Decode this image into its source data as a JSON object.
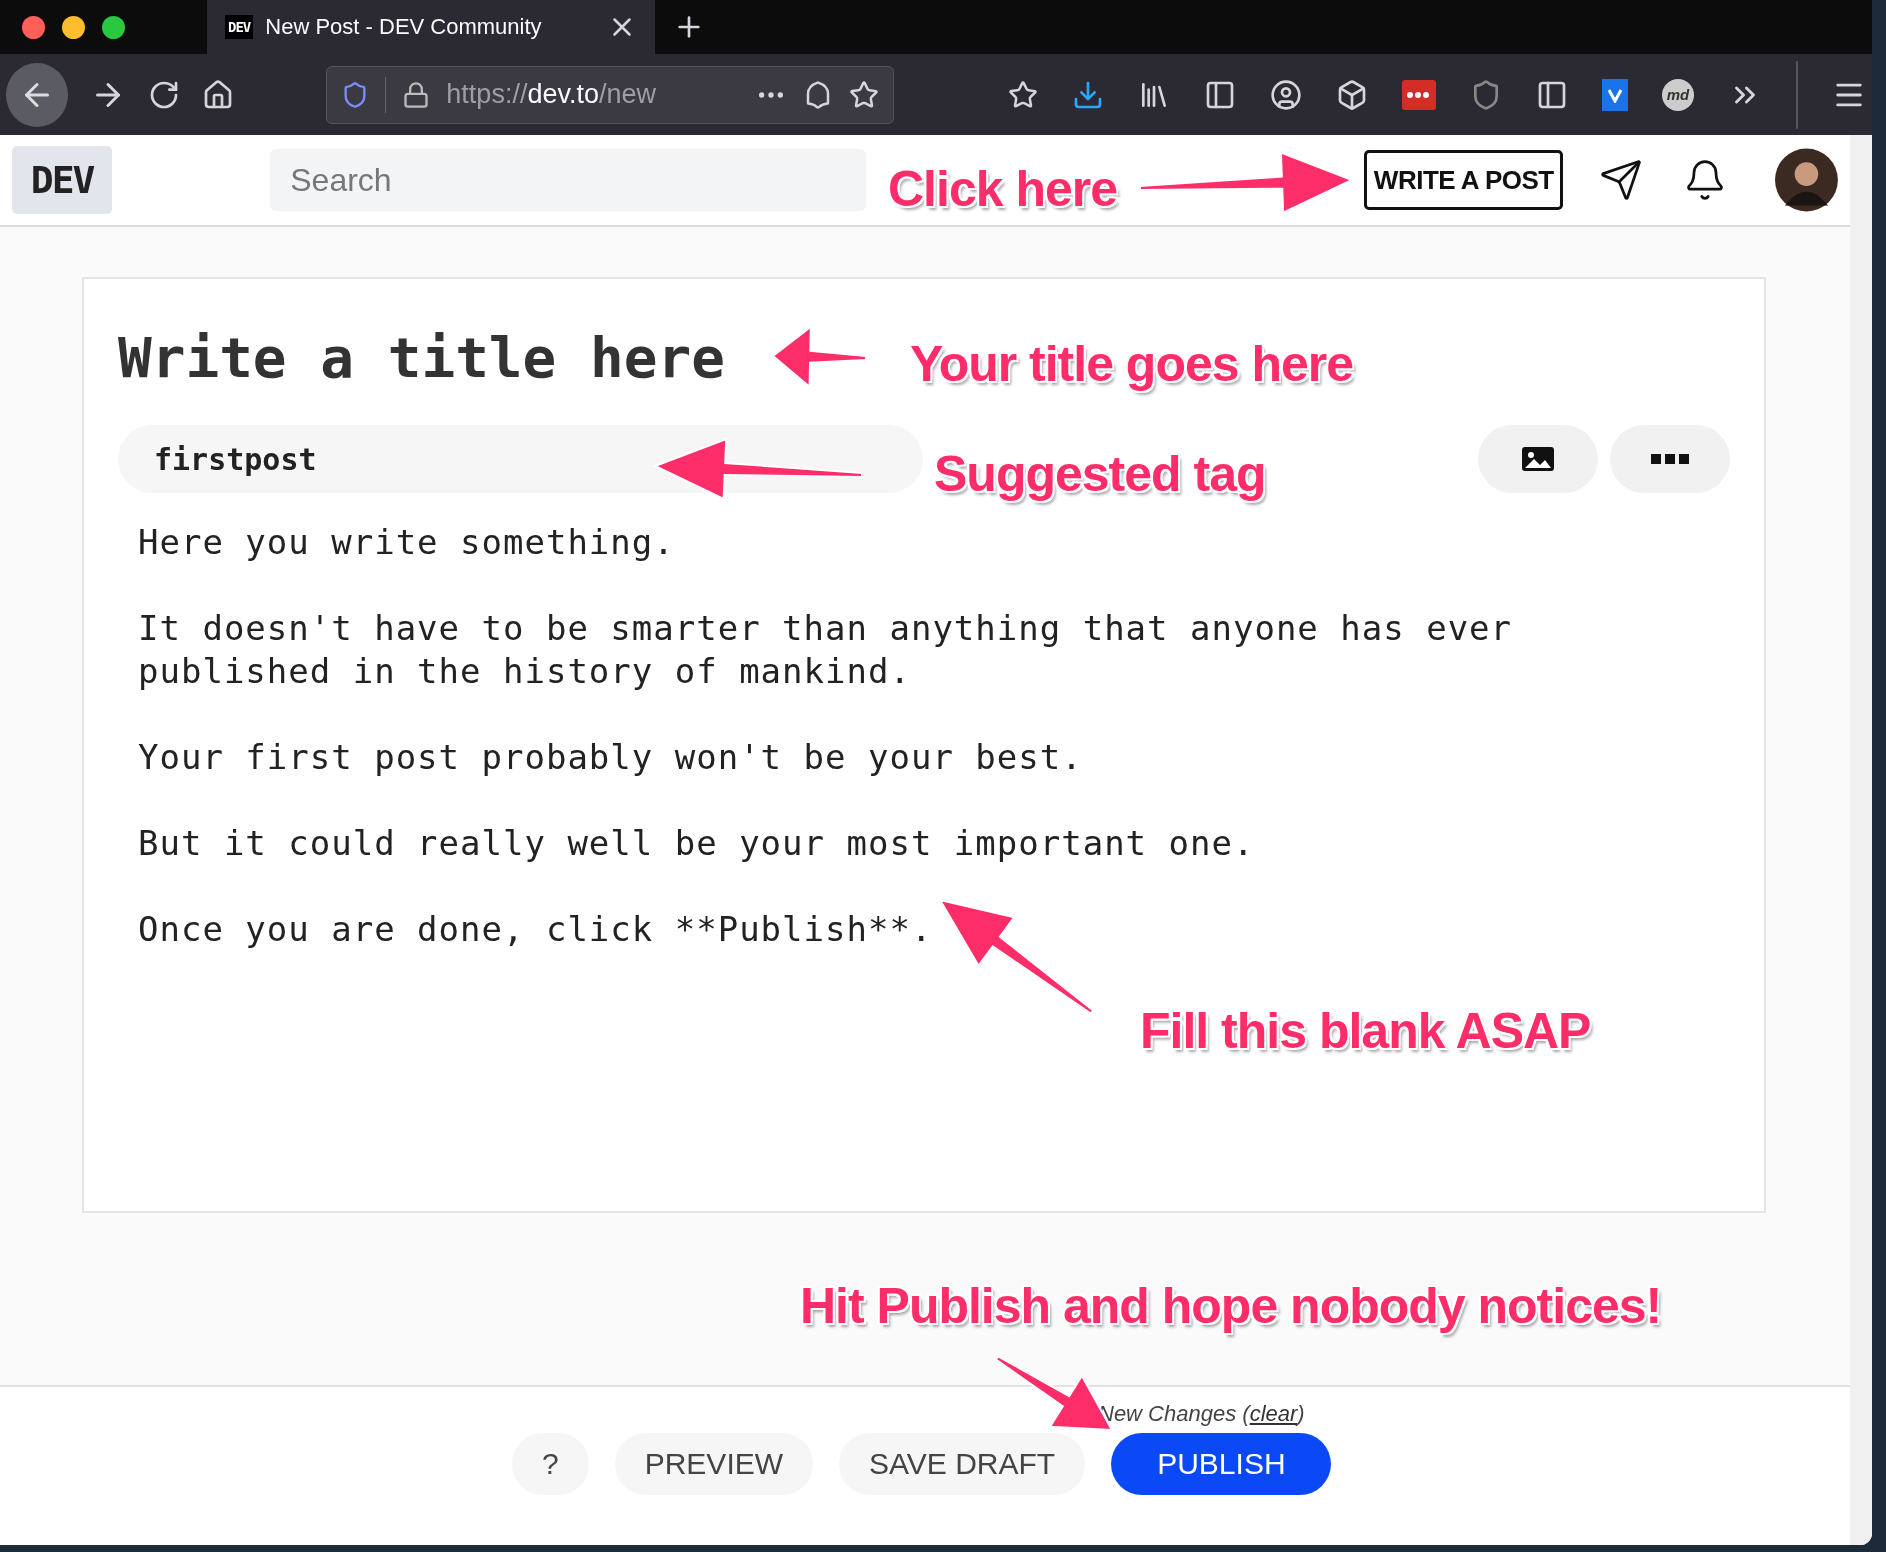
{
  "browser": {
    "tab": {
      "favicon": "DEV",
      "title": "New Post - DEV Community",
      "selected": true
    },
    "url": {
      "scheme": "https://",
      "host": "dev.to",
      "path": "/new"
    },
    "extension_badge": "md"
  },
  "header": {
    "logo": "DEV",
    "search": {
      "placeholder": "Search"
    },
    "write_button": "WRITE A POST"
  },
  "editor": {
    "title": {
      "placeholder": "Write a title here"
    },
    "tag": "firstpost",
    "body": [
      "Here you write something.",
      "It doesn't have to be smarter than anything that anyone has ever published in the history of mankind.",
      "Your first post probably won't be your best.",
      "But it could really well be your most important one.",
      "Once you are done, click **Publish**."
    ]
  },
  "footer": {
    "note": "New Changes (",
    "note_link": "clear",
    "note_end": ")",
    "buttons": [
      {
        "label": "?",
        "kind": "plain"
      },
      {
        "label": "PREVIEW",
        "kind": "plain"
      },
      {
        "label": "SAVE DRAFT",
        "kind": "plain"
      },
      {
        "label": "PUBLISH",
        "kind": "primary"
      }
    ]
  },
  "annotations": [
    "Click here",
    "Your title goes here",
    "Suggested tag",
    "Fill this blank ASAP",
    "Hit Publish and hope nobody notices!"
  ]
}
